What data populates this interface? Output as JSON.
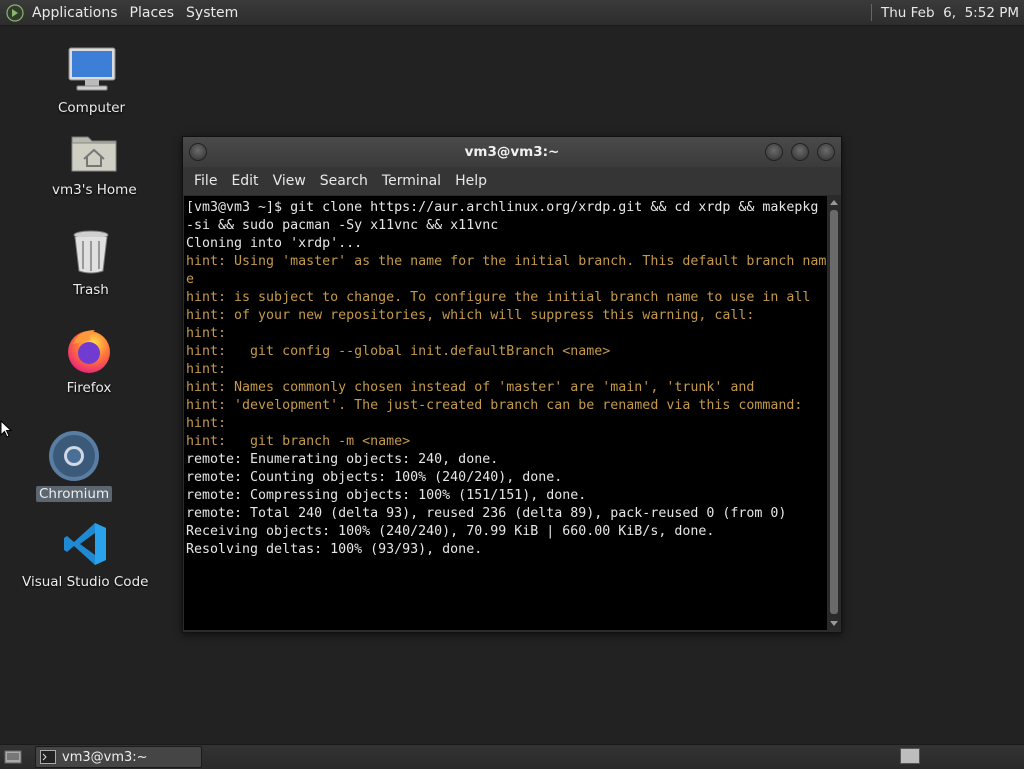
{
  "top_panel": {
    "menus": [
      "Applications",
      "Places",
      "System"
    ],
    "clock": "Thu Feb  6,  5:52 PM"
  },
  "desktop_icons": {
    "computer": "Computer",
    "home": "vm3's Home",
    "trash": "Trash",
    "firefox": "Firefox",
    "chromium": "Chromium",
    "vscode": "Visual Studio Code"
  },
  "terminal": {
    "title": "vm3@vm3:~",
    "menu": [
      "File",
      "Edit",
      "View",
      "Search",
      "Terminal",
      "Help"
    ],
    "lines": [
      {
        "text": "[vm3@vm3 ~]$ git clone https://aur.archlinux.org/xrdp.git && cd xrdp && makepkg",
        "style": "normal"
      },
      {
        "text": "-si && sudo pacman -Sy x11vnc && x11vnc",
        "style": "normal"
      },
      {
        "text": "Cloning into 'xrdp'...",
        "style": "normal"
      },
      {
        "text": "hint: Using 'master' as the name for the initial branch. This default branch nam",
        "style": "hint"
      },
      {
        "text": "e",
        "style": "hint"
      },
      {
        "text": "hint: is subject to change. To configure the initial branch name to use in all",
        "style": "hint"
      },
      {
        "text": "hint: of your new repositories, which will suppress this warning, call:",
        "style": "hint"
      },
      {
        "text": "hint:",
        "style": "hint"
      },
      {
        "text": "hint:   git config --global init.defaultBranch <name>",
        "style": "hint"
      },
      {
        "text": "hint:",
        "style": "hint"
      },
      {
        "text": "hint: Names commonly chosen instead of 'master' are 'main', 'trunk' and",
        "style": "hint"
      },
      {
        "text": "hint: 'development'. The just-created branch can be renamed via this command:",
        "style": "hint"
      },
      {
        "text": "hint:",
        "style": "hint"
      },
      {
        "text": "hint:   git branch -m <name>",
        "style": "hint"
      },
      {
        "text": "remote: Enumerating objects: 240, done.",
        "style": "normal"
      },
      {
        "text": "remote: Counting objects: 100% (240/240), done.",
        "style": "normal"
      },
      {
        "text": "remote: Compressing objects: 100% (151/151), done.",
        "style": "normal"
      },
      {
        "text": "remote: Total 240 (delta 93), reused 236 (delta 89), pack-reused 0 (from 0)",
        "style": "normal"
      },
      {
        "text": "Receiving objects: 100% (240/240), 70.99 KiB | 660.00 KiB/s, done.",
        "style": "normal"
      },
      {
        "text": "Resolving deltas: 100% (93/93), done.",
        "style": "normal"
      }
    ]
  },
  "taskbar": {
    "task_label": "vm3@vm3:~"
  },
  "colors": {
    "hint_text": "#c49a4a",
    "terminal_bg": "#000000",
    "desktop_bg": "#222222"
  }
}
